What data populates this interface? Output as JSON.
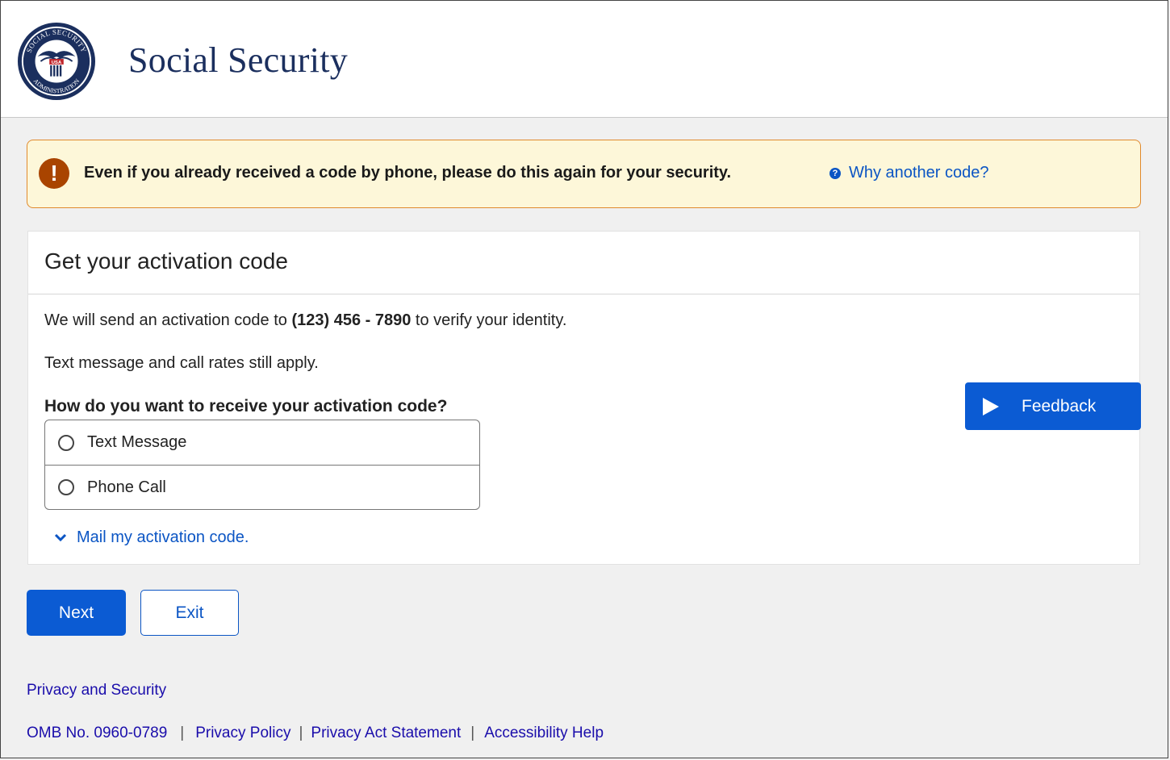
{
  "header": {
    "site_title": "Social Security",
    "seal_text_top": "SOCIAL SECURITY",
    "seal_text_bottom": "ADMINISTRATION",
    "seal_badge": "USA"
  },
  "alert": {
    "message": "Even if you already received a code by phone, please do this again for your security.",
    "link_label": "Why another code?",
    "icon": "exclamation-icon"
  },
  "card": {
    "title": "Get your activation code",
    "send_prefix": "We will send an activation code to ",
    "phone_number": "(123) 456 - 7890",
    "send_suffix": " to verify your identity.",
    "rates_note": "Text message and call rates still apply.",
    "question": "How do you want to receive your activation code?",
    "options": [
      {
        "label": "Text Message",
        "selected": false
      },
      {
        "label": "Phone Call",
        "selected": false
      }
    ],
    "mail_link": "Mail my activation code."
  },
  "feedback": {
    "label": "Feedback"
  },
  "buttons": {
    "next": "Next",
    "exit": "Exit"
  },
  "footer": {
    "privacy_security": "Privacy and Security",
    "omb": "OMB No. 0960-0789",
    "privacy_policy": "Privacy Policy",
    "privacy_act": "Privacy Act Statement",
    "accessibility": "Accessibility Help",
    "separator": "|"
  },
  "colors": {
    "brand_navy": "#1b2f5e",
    "primary_blue": "#0b5bd3",
    "alert_bg": "#fdf7d9",
    "alert_border": "#e08a2c",
    "alert_icon": "#a94400"
  }
}
